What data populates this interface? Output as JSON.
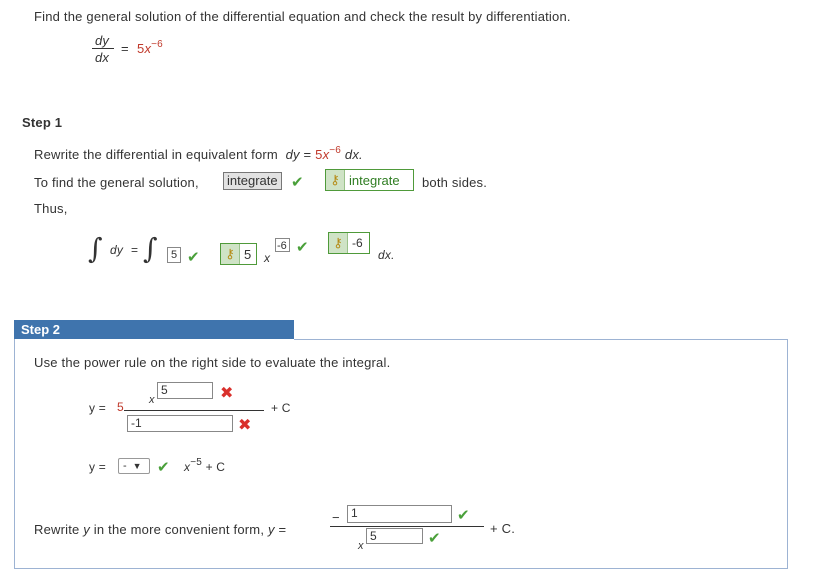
{
  "problem": {
    "prompt": "Find the general solution of the differential equation and check the result by differentiation.",
    "lhs_num": "dy",
    "lhs_den": "dx",
    "eq": "=",
    "rhs_coef": "5",
    "rhs_var": "x",
    "rhs_exp": "−6"
  },
  "step1": {
    "label": "Step 1",
    "rewrite_text": "Rewrite the differential in equivalent form",
    "rewrite_dy": "dy",
    "rewrite_eq": "=",
    "rewrite_coef": "5",
    "rewrite_var": "x",
    "rewrite_exp": "−6",
    "rewrite_dx": "dx.",
    "find_text": "To find the general solution,",
    "find_input": "integrate",
    "find_answer": "integrate",
    "find_after": "both sides.",
    "thus": "Thus,",
    "integral_lhs": "dy",
    "integral_eq": "=",
    "coef_input": "5",
    "coef_answer": "5",
    "var_x": "x",
    "exp_input": "-6",
    "exp_answer": "-6",
    "dx": "dx."
  },
  "step2": {
    "label": "Step 2",
    "instruction": "Use the power rule on the right side to evaluate the integral.",
    "y_label": "y =",
    "coef": "5",
    "num_x": "x",
    "num_input": "5",
    "den_input": "-1",
    "plus_c": "+ C",
    "y2_label": "y =",
    "select_value": "-",
    "x_var": "x",
    "x_exp": "−5",
    "plus_c2": "+ C",
    "rewrite_text": "Rewrite",
    "rewrite_y": "y",
    "rewrite_rest": "in the more convenient form,",
    "rewrite_y2": "y",
    "rewrite_eq": "=",
    "minus": "−",
    "num_input2": "1",
    "den_x": "x",
    "den_input2": "5",
    "plus_c3": "+ C."
  },
  "icons": {
    "check": "✔",
    "cross": "✖",
    "key": "⚷"
  },
  "colors": {
    "step_header_bg": "#3f74ad",
    "correct_green": "#4aa03a",
    "incorrect_red": "#d9302c",
    "answer_border": "#4f9a3a",
    "red_text": "#c0392b"
  }
}
